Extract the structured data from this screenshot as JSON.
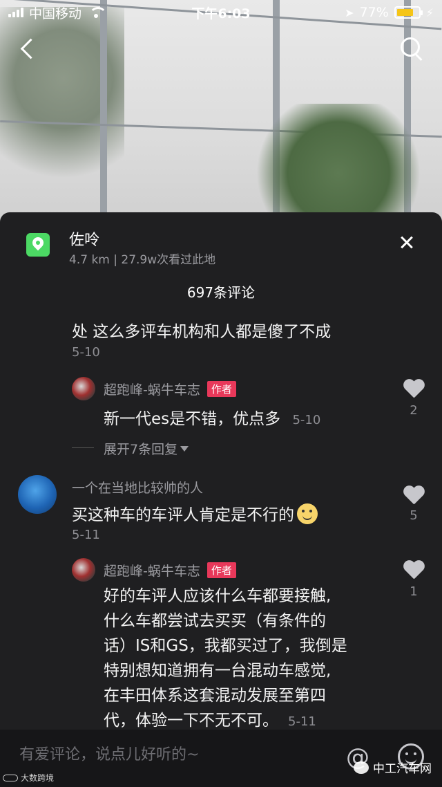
{
  "status_bar": {
    "carrier": "中国移动",
    "time": "下午6:03",
    "battery_percent": "77%",
    "battery_level": 0.77
  },
  "location": {
    "name": "佐呤",
    "meta": "4.7 km  |  27.9w次看过此地"
  },
  "comments_header": "697条评论",
  "comments": [
    {
      "text": "处 这么多评车机构和人都是傻了不成",
      "date": "5-10",
      "reply": {
        "user": "超跑峰-蜗牛车志",
        "tag": "作者",
        "text": "新一代es是不错，优点多",
        "date": "5-10",
        "likes": "2"
      },
      "expand": "展开7条回复"
    },
    {
      "user": "一个在当地比较帅的人",
      "text": "买这种车的车评人肯定是不行的",
      "date": "5-11",
      "likes": "5",
      "reply": {
        "user": "超跑峰-蜗牛车志",
        "tag": "作者",
        "lines": [
          "好的车评人应该什么车都要接触,",
          "什么车都尝试去买买（有条件的",
          "话）IS和GS，我都买过了，我倒是",
          "特别想知道拥有一台混动车感觉,",
          "在丰田体系这套混动发展至第四",
          "代，体验一下不无不可。"
        ],
        "date": "5-11",
        "likes": "1"
      }
    }
  ],
  "input": {
    "placeholder": "有爱评论，说点儿好听的~"
  },
  "watermarks": {
    "right": "中工汽车网",
    "left": "大数跨境"
  }
}
